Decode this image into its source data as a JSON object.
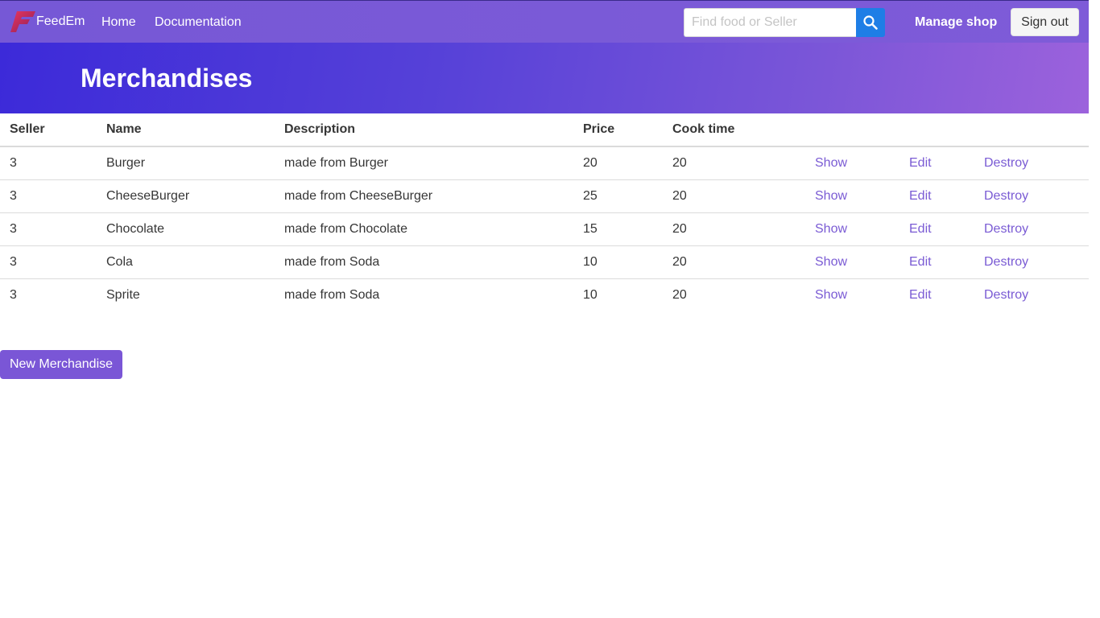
{
  "nav": {
    "brand": "FeedEm",
    "brand_icon": "feedem-logo-icon",
    "links": [
      "Home",
      "Documentation"
    ],
    "search_placeholder": "Find food or Seller",
    "search_icon": "search-icon",
    "manage_shop": "Manage shop",
    "sign_out": "Sign out"
  },
  "page": {
    "title": "Merchandises"
  },
  "table": {
    "headers": [
      "Seller",
      "Name",
      "Description",
      "Price",
      "Cook time"
    ],
    "rows": [
      [
        "3",
        "Burger",
        "made from Burger",
        "20",
        "20"
      ],
      [
        "3",
        "CheeseBurger",
        "made from CheeseBurger",
        "25",
        "20"
      ],
      [
        "3",
        "Chocolate",
        "made from Chocolate",
        "15",
        "20"
      ],
      [
        "3",
        "Cola",
        "made from Soda",
        "10",
        "20"
      ],
      [
        "3",
        "Sprite",
        "made from Soda",
        "10",
        "20"
      ]
    ],
    "actions": [
      "Show",
      "Edit",
      "Destroy"
    ]
  },
  "new_button": "New Merchandise",
  "colors": {
    "navbar": "#7658d6",
    "hero_start": "#3c2ad9",
    "hero_end": "#9c62dc",
    "link": "#7a5bd4",
    "search_button": "#1e7ee6",
    "primary_button": "#7a56d6"
  }
}
